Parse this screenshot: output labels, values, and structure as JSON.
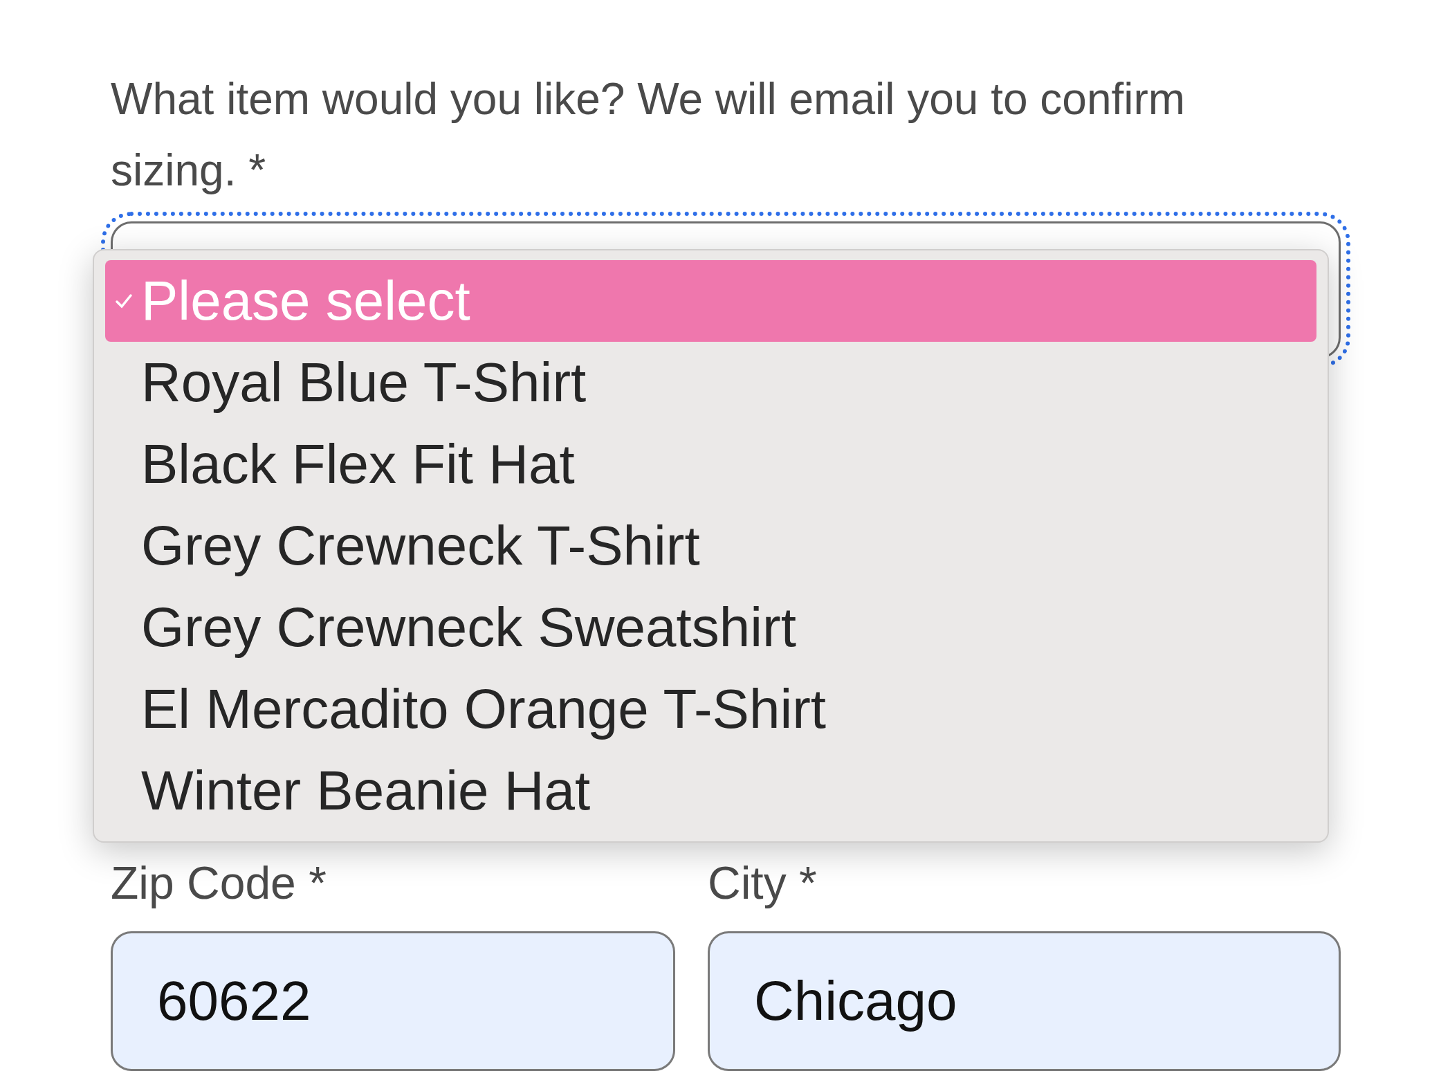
{
  "question": {
    "label": "What item would you like? We will email you to confirm sizing. *"
  },
  "item_select": {
    "focused": true,
    "options": [
      {
        "label": "Please select",
        "selected": true
      },
      {
        "label": "Royal Blue T-Shirt",
        "selected": false
      },
      {
        "label": "Black Flex Fit Hat",
        "selected": false
      },
      {
        "label": "Grey Crewneck T-Shirt",
        "selected": false
      },
      {
        "label": "Grey Crewneck Sweatshirt",
        "selected": false
      },
      {
        "label": "El Mercadito Orange T-Shirt",
        "selected": false
      },
      {
        "label": "Winter Beanie Hat",
        "selected": false
      }
    ]
  },
  "fields": [
    {
      "label": "Zip Code *",
      "value": "60622"
    },
    {
      "label": "City *",
      "value": "Chicago"
    }
  ]
}
